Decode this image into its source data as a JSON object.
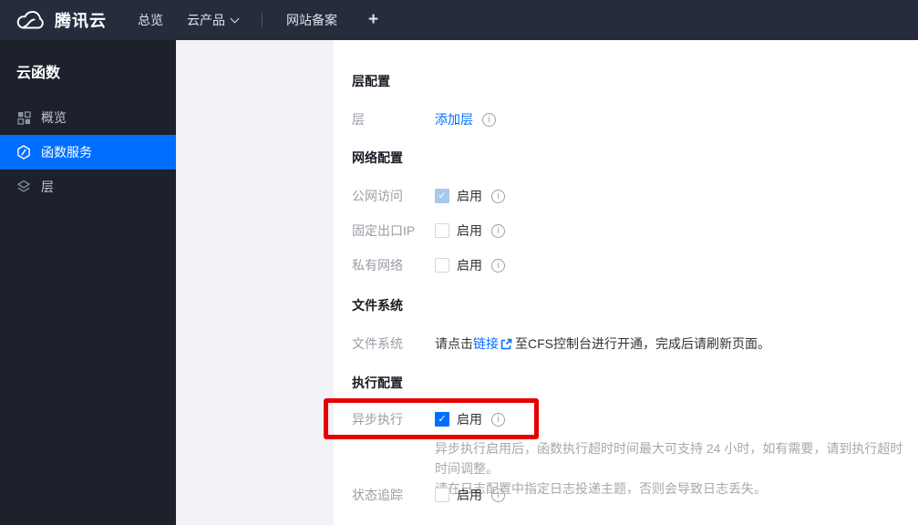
{
  "colors": {
    "navbar_bg": "#252d3d",
    "sidebar_bg": "#1c212c",
    "active_blue": "#006eff",
    "link_blue": "#006eff",
    "page_bg": "#f2f3f6",
    "panel_bg": "#ffffff",
    "highlight_red": "#e60000",
    "disabled_checked_blue": "#a6c9f0"
  },
  "navbar": {
    "brand": "腾讯云",
    "items": [
      {
        "label": "总览"
      },
      {
        "label": "云产品",
        "has_chevron": true
      },
      {
        "label": "网站备案"
      },
      {
        "label": "+"
      }
    ]
  },
  "sidebar": {
    "title": "云函数",
    "items": [
      {
        "label": "概览",
        "icon": "grid-icon",
        "active": false
      },
      {
        "label": "函数服务",
        "icon": "function-hexagon-icon",
        "active": true
      },
      {
        "label": "层",
        "icon": "layers-icon",
        "active": false
      }
    ]
  },
  "main": {
    "sections": [
      {
        "title": "层配置",
        "rows": [
          {
            "label": "层",
            "type": "link",
            "link_text": "添加层",
            "has_info": true
          }
        ]
      },
      {
        "title": "网络配置",
        "rows": [
          {
            "label": "公网访问",
            "type": "checkbox",
            "checkbox_label": "启用",
            "state": "checked-disabled",
            "has_info": true
          },
          {
            "label": "固定出口IP",
            "type": "checkbox",
            "checkbox_label": "启用",
            "state": "unchecked",
            "has_info": true
          },
          {
            "label": "私有网络",
            "type": "checkbox",
            "checkbox_label": "启用",
            "state": "unchecked",
            "has_info": true
          }
        ]
      },
      {
        "title": "文件系统",
        "rows": [
          {
            "label": "文件系统",
            "type": "text-with-link",
            "text_before": "请点击",
            "link_text": "链接",
            "ext_link_icon": "external-link-icon",
            "text_after": "至CFS控制台进行开通，完成后请刷新页面。"
          }
        ]
      },
      {
        "title": "执行配置",
        "rows": [
          {
            "label": "异步执行",
            "type": "checkbox",
            "checkbox_label": "启用",
            "state": "checked",
            "has_info": true,
            "highlighted": true,
            "help_lines": [
              "异步执行启用后，函数执行超时时间最大可支持 24 小时，如有需要，请到执行超时时间调整。",
              "请在日志配置中指定日志投递主题，否则会导致日志丢失。"
            ]
          },
          {
            "label": "状态追踪",
            "type": "checkbox",
            "checkbox_label": "启用",
            "state": "unchecked",
            "has_info": true
          }
        ]
      }
    ]
  },
  "glyphs": {
    "check": "✓",
    "info": "i"
  }
}
